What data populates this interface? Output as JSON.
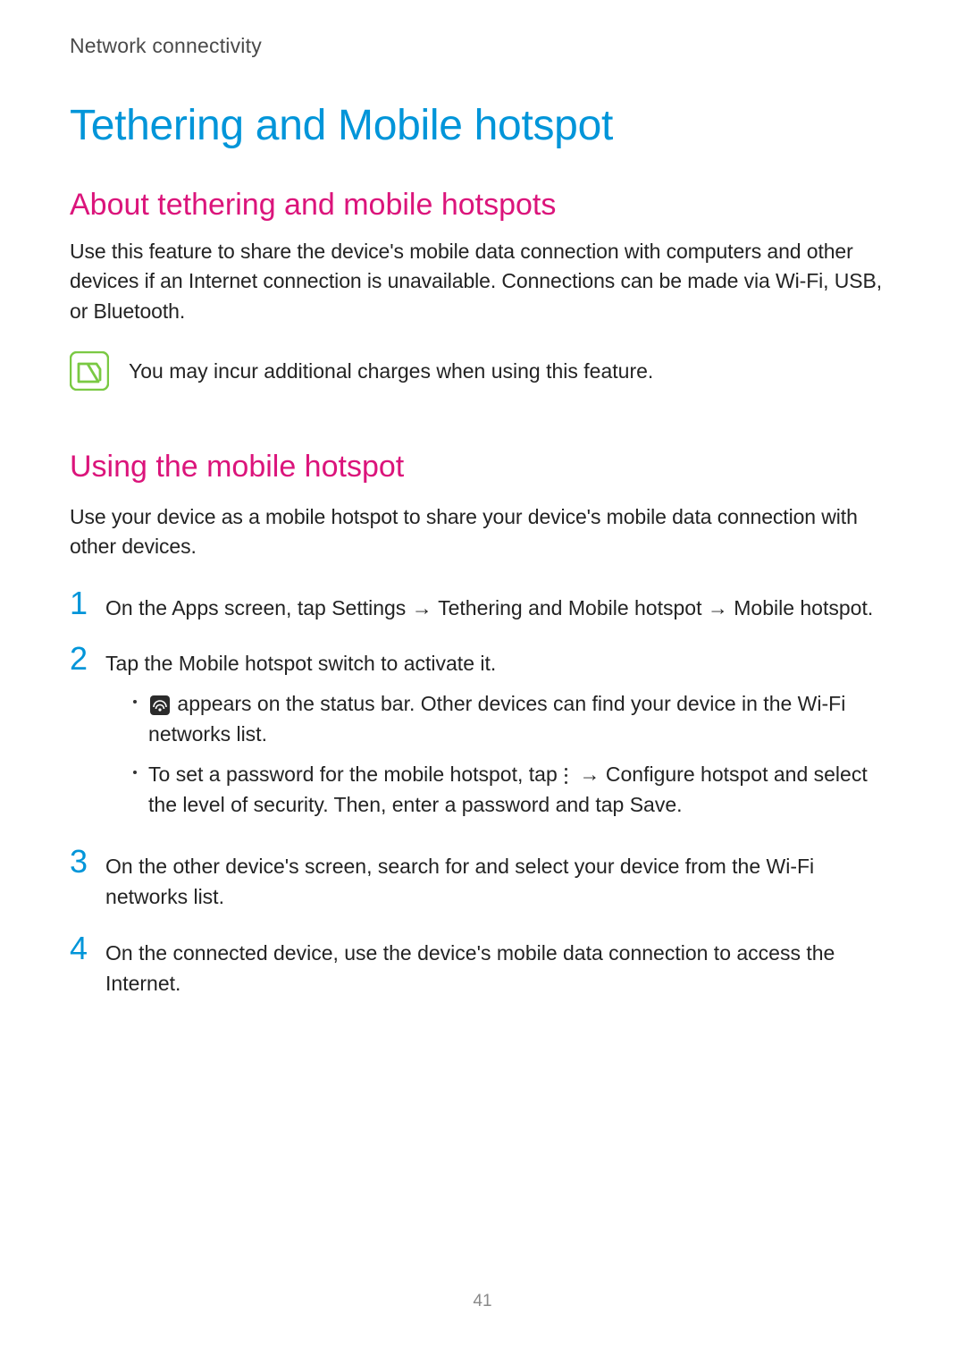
{
  "header": "Network connectivity",
  "title": "Tethering and Mobile hotspot",
  "section1": {
    "heading": "About tethering and mobile hotspots",
    "para": "Use this feature to share the device's mobile data connection with computers and other devices if an Internet connection is unavailable. Connections can be made via Wi-Fi, USB, or Bluetooth.",
    "note": "You may incur additional charges when using this feature."
  },
  "section2": {
    "heading": "Using the mobile hotspot",
    "para": "Use your device as a mobile hotspot to share your device's mobile data connection with other devices.",
    "step1": {
      "pre": "On the Apps screen, tap ",
      "b1": "Settings",
      "arrow1": " → ",
      "b2": "Tethering and Mobile hotspot",
      "arrow2": " → ",
      "b3": "Mobile hotspot",
      "post": "."
    },
    "step2": {
      "pre": "Tap the ",
      "b1": "Mobile hotspot",
      "post": " switch to activate it.",
      "bullet1_post": " appears on the status bar. Other devices can find your device in the Wi-Fi networks list.",
      "bullet2_pre": "To set a password for the mobile hotspot, tap ",
      "bullet2_arrow": " → ",
      "bullet2_b1": "Configure hotspot",
      "bullet2_mid": " and select the level of security. Then, enter a password and tap ",
      "bullet2_b2": "Save",
      "bullet2_post": "."
    },
    "step3": "On the other device's screen, search for and select your device from the Wi-Fi networks list.",
    "step4": "On the connected device, use the device's mobile data connection to access the Internet."
  },
  "page_number": "41"
}
